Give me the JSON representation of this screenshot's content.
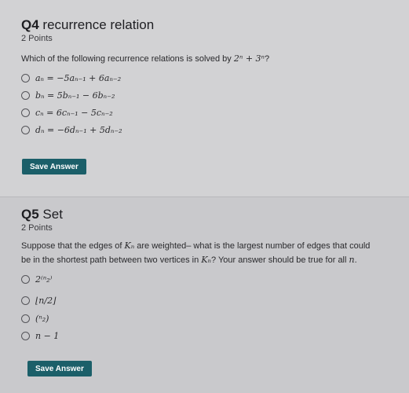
{
  "q4": {
    "title_bold": "Q4",
    "title_rest": " recurrence relation",
    "points": "2 Points",
    "prompt": "Which of the following recurrence relations is solved by ",
    "prompt_math": "2ⁿ + 3ⁿ",
    "prompt_end": "?",
    "options": [
      "aₙ = −5aₙ₋₁ + 6aₙ₋₂",
      "bₙ = 5bₙ₋₁ − 6bₙ₋₂",
      "cₙ = 6cₙ₋₁ − 5cₙ₋₂",
      "dₙ = −6dₙ₋₁ + 5dₙ₋₂"
    ],
    "save_label": "Save Answer"
  },
  "q5": {
    "title_bold": "Q5",
    "title_rest": " Set",
    "points": "2 Points",
    "prompt_line1_a": "Suppose that the edges of ",
    "prompt_line1_math": "Kₙ",
    "prompt_line1_b": " are weighted– what is the largest number of edges that could",
    "prompt_line2_a": "be in the shortest path between two vertices in ",
    "prompt_line2_math": "Kₙ",
    "prompt_line2_b": "? Your answer should be true for all ",
    "prompt_line2_math2": "n",
    "prompt_line2_c": ".",
    "options": [
      "2⁽ⁿ₂⁾",
      "⌊n/2⌋",
      "(ⁿ₂)",
      "n − 1"
    ],
    "save_label": "Save Answer"
  }
}
